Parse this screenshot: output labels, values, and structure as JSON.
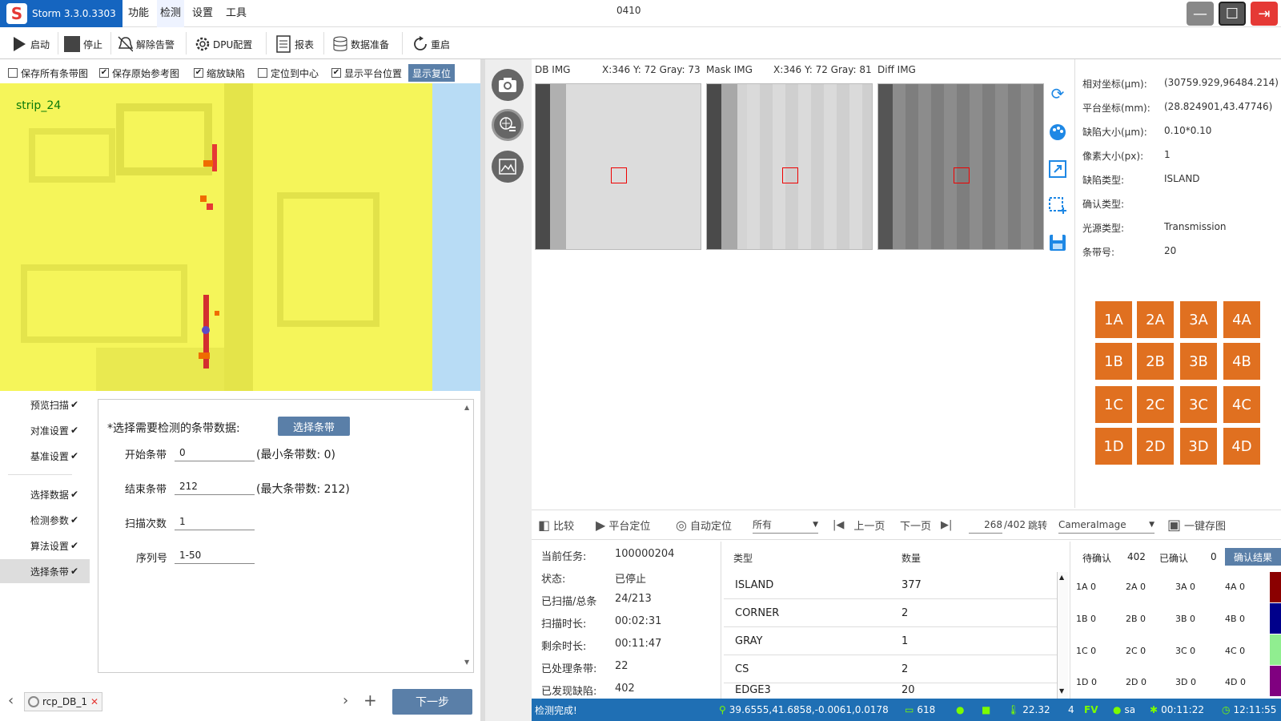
{
  "app": {
    "title": "Storm 3.3.0.3303",
    "window_text": "0410"
  },
  "menu": [
    "功能",
    "检测",
    "设置",
    "工具"
  ],
  "toolbar": {
    "start": "启动",
    "stop": "停止",
    "clear_alarm": "解除告警",
    "dpu": "DPU配置",
    "report": "报表",
    "data_prep": "数据准备",
    "restart": "重启"
  },
  "checkboxes": [
    {
      "label": "保存所有条带图",
      "checked": false
    },
    {
      "label": "保存原始参考图",
      "checked": true
    },
    {
      "label": "缩放缺陷",
      "checked": true
    },
    {
      "label": "定位到中心",
      "checked": false
    },
    {
      "label": "显示平台位置",
      "checked": true
    }
  ],
  "show_reset": "显示复位",
  "strip_label": "strip_24",
  "nav": [
    {
      "label": "预览扫描",
      "check": "✔"
    },
    {
      "label": "对准设置",
      "check": "✔"
    },
    {
      "label": "基准设置",
      "check": "✔"
    },
    {
      "label": "选择数据",
      "check": "✔"
    },
    {
      "label": "检测参数",
      "check": "✔"
    },
    {
      "label": "算法设置",
      "check": "✔"
    },
    {
      "label": "选择条带",
      "check": "✔"
    }
  ],
  "form": {
    "prompt": "*选择需要检测的条带数据:",
    "select_button": "选择条带",
    "start_label": "开始条带",
    "start_value": "0",
    "start_hint": "(最小条带数: 0)",
    "end_label": "结束条带",
    "end_value": "212",
    "end_hint": "(最大条带数: 212)",
    "scan_label": "扫描次数",
    "scan_value": "1",
    "serial_label": "序列号",
    "serial_value": "1-50"
  },
  "bottom": {
    "db_tab": "rcp_DB_1",
    "close": "✕",
    "next": "下一步"
  },
  "images": {
    "db_label": "DB IMG",
    "db_coord": "X:346 Y:  72 Gray:  73",
    "mask_label": "Mask IMG",
    "mask_coord": "X:346 Y:  72 Gray:  81",
    "diff_label": "Diff IMG"
  },
  "info": [
    {
      "k": "相对坐标(μm):",
      "v": "(30759.929,96484.214)"
    },
    {
      "k": "平台坐标(mm):",
      "v": "(28.824901,43.47746)"
    },
    {
      "k": "缺陷大小(μm):",
      "v": "0.10*0.10"
    },
    {
      "k": "像素大小(px):",
      "v": "1"
    },
    {
      "k": "缺陷类型:",
      "v": "ISLAND"
    },
    {
      "k": "确认类型:",
      "v": ""
    },
    {
      "k": "光源类型:",
      "v": "Transmission"
    },
    {
      "k": "条带号:",
      "v": "20"
    }
  ],
  "grid": [
    [
      "1A",
      "2A",
      "3A",
      "4A"
    ],
    [
      "1B",
      "2B",
      "3B",
      "4B"
    ],
    [
      "1C",
      "2C",
      "3C",
      "4C"
    ],
    [
      "1D",
      "2D",
      "3D",
      "4D"
    ]
  ],
  "grid_color": "#e07020",
  "lower_toolbar": {
    "compare": "比较",
    "platform": "平台定位",
    "auto": "自动定位",
    "filter": "所有",
    "prev": "上一页",
    "next": "下一页",
    "page": "268",
    "total": "/402",
    "jump": "跳转",
    "source": "CameraImage",
    "save_all": "一键存图"
  },
  "stats": [
    {
      "k": "当前任务:",
      "v": "100000204"
    },
    {
      "k": "状态:",
      "v": "已停止"
    },
    {
      "k": "已扫描/总条",
      "v": "24/213"
    },
    {
      "k": "扫描时长:",
      "v": "00:02:31"
    },
    {
      "k": "剩余时长:",
      "v": "00:11:47"
    },
    {
      "k": "已处理条带:",
      "v": "22"
    },
    {
      "k": "已发现缺陷:",
      "v": "402"
    }
  ],
  "type_table": {
    "headers": [
      "类型",
      "数量"
    ],
    "rows": [
      [
        "ISLAND",
        "377"
      ],
      [
        "CORNER",
        "2"
      ],
      [
        "GRAY",
        "1"
      ],
      [
        "CS",
        "2"
      ],
      [
        "EDGE3",
        "20"
      ]
    ]
  },
  "confirm": {
    "pending_label": "待确认",
    "pending": "402",
    "confirmed_label": "已确认",
    "confirmed": "0",
    "button": "确认结果",
    "rows": [
      [
        "1A 0",
        "2A 0",
        "3A 0",
        "4A 0"
      ],
      [
        "1B 0",
        "2B 0",
        "3B 0",
        "4B 0"
      ],
      [
        "1C 0",
        "2C 0",
        "3C 0",
        "4C 0"
      ],
      [
        "1D 0",
        "2D 0",
        "3D 0",
        "4D 0"
      ]
    ],
    "colors": [
      "#8b0000",
      "#00008b",
      "#90ee90",
      "#800080"
    ]
  },
  "status": {
    "message": "检测完成!",
    "coords": "39.6555,41.6858,-0.0061,0.0178",
    "count": "618",
    "temp": "22.32",
    "num": "4",
    "fv": "FV",
    "user": "sa",
    "elapsed": "00:11:22",
    "clock": "12:11:55"
  }
}
